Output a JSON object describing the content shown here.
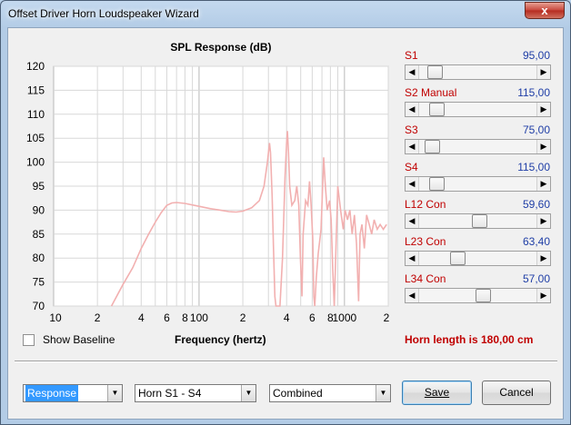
{
  "window": {
    "title": "Offset Driver Horn Loudspeaker Wizard",
    "close_glyph": "x"
  },
  "chart": {
    "title": "SPL Response (dB)"
  },
  "chart_data": {
    "type": "line",
    "title": "SPL Response (dB)",
    "xlabel": "Frequency (hertz)",
    "ylabel": "",
    "x_scale": "log",
    "xlim": [
      10,
      2000
    ],
    "ylim": [
      70,
      120
    ],
    "grid": true,
    "y_ticks": [
      "120",
      "115",
      "110",
      "105",
      "100",
      "95",
      "90",
      "85",
      "80",
      "75",
      "70"
    ],
    "x_ticks": [
      "10",
      "2",
      "4",
      "6",
      "8",
      "100",
      "2",
      "4",
      "6",
      "8",
      "1000",
      "2"
    ],
    "series": [
      {
        "color": "#f2b0b0",
        "points": [
          [
            25,
            70
          ],
          [
            30,
            74.5
          ],
          [
            35,
            78
          ],
          [
            40,
            82
          ],
          [
            45,
            85
          ],
          [
            50,
            87.5
          ],
          [
            55,
            89.5
          ],
          [
            60,
            91
          ],
          [
            65,
            91.5
          ],
          [
            70,
            91.6
          ],
          [
            80,
            91.4
          ],
          [
            100,
            90.8
          ],
          [
            120,
            90.3
          ],
          [
            140,
            90
          ],
          [
            160,
            89.7
          ],
          [
            180,
            89.6
          ],
          [
            200,
            89.8
          ],
          [
            230,
            90.5
          ],
          [
            260,
            92
          ],
          [
            280,
            95
          ],
          [
            295,
            100
          ],
          [
            305,
            104
          ],
          [
            310,
            102
          ],
          [
            318,
            93
          ],
          [
            325,
            82
          ],
          [
            332,
            72
          ],
          [
            338,
            70
          ],
          [
            360,
            70
          ],
          [
            375,
            80
          ],
          [
            390,
            97
          ],
          [
            400,
            104
          ],
          [
            405,
            106.5
          ],
          [
            412,
            102
          ],
          [
            420,
            95
          ],
          [
            435,
            91
          ],
          [
            455,
            92
          ],
          [
            470,
            95
          ],
          [
            485,
            91
          ],
          [
            498,
            80
          ],
          [
            510,
            72
          ],
          [
            520,
            85
          ],
          [
            540,
            92
          ],
          [
            560,
            91
          ],
          [
            575,
            96
          ],
          [
            590,
            91
          ],
          [
            605,
            84
          ],
          [
            615,
            72
          ],
          [
            625,
            70
          ],
          [
            640,
            76
          ],
          [
            660,
            81
          ],
          [
            690,
            86
          ],
          [
            720,
            101
          ],
          [
            735,
            96
          ],
          [
            760,
            90
          ],
          [
            790,
            92
          ],
          [
            810,
            88
          ],
          [
            830,
            78
          ],
          [
            850,
            70
          ],
          [
            870,
            80
          ],
          [
            900,
            95
          ],
          [
            940,
            90
          ],
          [
            980,
            86
          ],
          [
            1010,
            90
          ],
          [
            1050,
            88
          ],
          [
            1090,
            90
          ],
          [
            1130,
            85
          ],
          [
            1170,
            89
          ],
          [
            1210,
            83
          ],
          [
            1250,
            71
          ],
          [
            1280,
            85
          ],
          [
            1320,
            87
          ],
          [
            1370,
            82
          ],
          [
            1420,
            89
          ],
          [
            1480,
            87
          ],
          [
            1540,
            85
          ],
          [
            1600,
            88
          ],
          [
            1680,
            86
          ],
          [
            1760,
            87
          ],
          [
            1850,
            86
          ],
          [
            1950,
            87
          ]
        ]
      }
    ]
  },
  "controls": [
    {
      "label": "S1",
      "value": "95,00",
      "pos": 0.08
    },
    {
      "label": "S2  Manual",
      "value": "115,00",
      "pos": 0.1
    },
    {
      "label": "S3",
      "value": "75,00",
      "pos": 0.05
    },
    {
      "label": "S4",
      "value": "115,00",
      "pos": 0.1
    },
    {
      "label": "L12  Con",
      "value": "59,60",
      "pos": 0.52
    },
    {
      "label": "L23  Con",
      "value": "63,40",
      "pos": 0.3
    },
    {
      "label": "L34  Con",
      "value": "57,00",
      "pos": 0.55
    }
  ],
  "show_baseline": {
    "label": "Show Baseline",
    "checked": false
  },
  "horn_length_text": "Horn length is 180,00 cm",
  "bottom": {
    "view_select": "Response",
    "horn_select": "Horn S1 - S4",
    "mode_select": "Combined",
    "save_label": "Save",
    "cancel_label": "Cancel"
  }
}
